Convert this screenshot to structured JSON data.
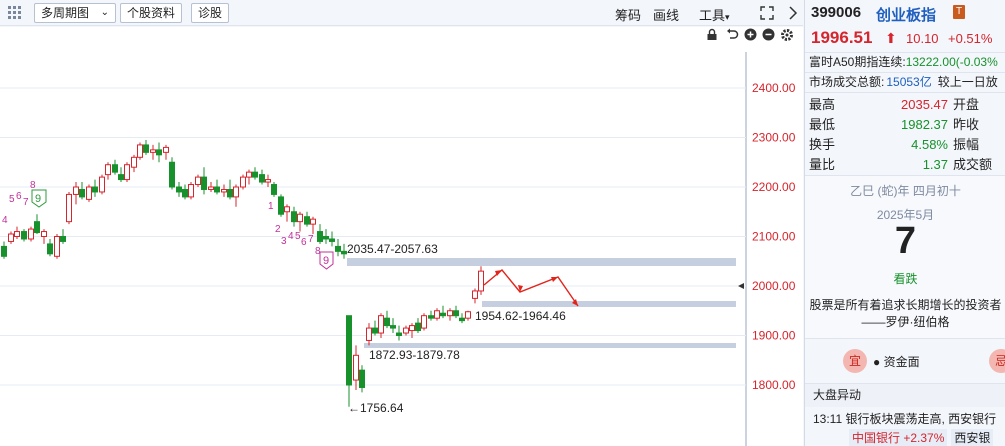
{
  "toolbar": {
    "period_label": "多周期图",
    "stock_info_label": "个股资料",
    "diagnose_label": "诊股",
    "chips_label": "筹码",
    "draw_label": "画线",
    "tools_label": "工具"
  },
  "chart": {
    "y_ticks": [
      "2400.00",
      "2300.00",
      "2200.00",
      "2100.00",
      "2000.00",
      "1900.00",
      "1800.00"
    ],
    "annotations": {
      "zone_top": "2035.47-2057.63",
      "zone_mid": "1954.62-1964.46",
      "zone_low": "1872.93-1879.78",
      "low_point": "←1756.64"
    },
    "td_marks_left": [
      "4",
      "5",
      "6",
      "7",
      "8",
      "9"
    ],
    "td_marks_right": [
      "1",
      "2",
      "3",
      "4",
      "5",
      "6",
      "7",
      "8",
      "9"
    ],
    "colors": {
      "up": "#d6252d",
      "down": "#17912c",
      "zone": "#c5cfe0"
    }
  },
  "right_panel": {
    "code": "399006",
    "name": "创业板指",
    "badge": "T",
    "price": "1996.51",
    "change": "10.10",
    "change_pct": "+0.51%",
    "futures_label": "富时A50期指连续:",
    "futures_value": "13222.00(-0.03%",
    "turnover_label": "市场成交总额:",
    "turnover_value": "15053亿",
    "turnover_compare": "较上一日放",
    "stats": [
      {
        "k": "最高",
        "v": "2035.47",
        "k2": "开盘",
        "color": "red"
      },
      {
        "k": "最低",
        "v": "1982.37",
        "k2": "昨收",
        "color": "green"
      },
      {
        "k": "换手",
        "v": "4.58%",
        "k2": "振幅",
        "color": "green"
      },
      {
        "k": "量比",
        "v": "1.37",
        "k2": "成交额",
        "color": "green"
      }
    ],
    "calendar": {
      "lunar": "乙巳 (蛇)年 四月初十",
      "month": "2025年5月",
      "day": "7",
      "state": "看跌",
      "quote": "股票是所有着追求长期增长的投资者",
      "author": "——罗伊·纽伯格"
    },
    "tab_tag_1": "宜",
    "tab_label": "● 资金面",
    "tab_tag_2": "忌",
    "news_header": "大盘异动",
    "news_text": "13:11 银行板块震荡走高, 西安银行",
    "news_tags": [
      "中国银行 +2.37%",
      "西安银"
    ]
  }
}
